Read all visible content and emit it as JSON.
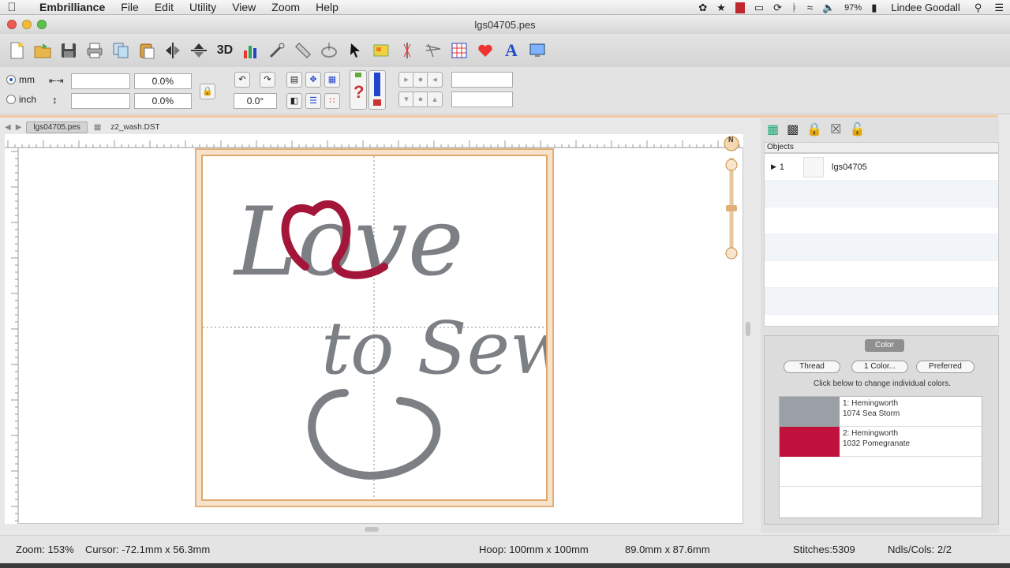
{
  "menubar": {
    "app_name": "Embrilliance",
    "menus": [
      "File",
      "Edit",
      "Utility",
      "View",
      "Zoom",
      "Help"
    ],
    "battery": "97%",
    "user": "Lindee Goodall"
  },
  "window": {
    "title": "lgs04705.pes"
  },
  "toolbar": {
    "icons": [
      "new-icon",
      "open-icon",
      "save-icon",
      "print-icon",
      "copy-icon",
      "paste-icon",
      "flip-horizontal-icon",
      "flip-vertical-icon",
      "3d-icon",
      "chart-icon",
      "wand-icon",
      "ruler-icon",
      "hoop-icon",
      "select-arrow-icon",
      "card-icon",
      "needle-icon",
      "stitch-icon",
      "grid-icon",
      "hearts-icon",
      "text-a-icon",
      "monitor-icon"
    ],
    "label_3d": "3D",
    "label_a": "A"
  },
  "props": {
    "mm_label": "mm",
    "inch_label": "inch",
    "width_pct": "0.0%",
    "height_pct": "0.0%",
    "rotation": "0.0°"
  },
  "doc_tabs": [
    "lgs04705.pes",
    "z2_wash.DST"
  ],
  "canvas": {
    "line1": "Love",
    "line2": "to Sew"
  },
  "objects": {
    "header": "Objects",
    "items": [
      {
        "index": "1",
        "name": "lgs04705"
      }
    ]
  },
  "color_panel": {
    "tab_label": "Color",
    "buttons": [
      "Thread",
      "1 Color...",
      "Preferred"
    ],
    "hint": "Click below to change individual colors.",
    "threads": [
      {
        "label1": "1: Hemingworth",
        "label2": "1074 Sea Storm",
        "color": "#9aa0a6"
      },
      {
        "label1": "2: Hemingworth",
        "label2": "1032 Pomegranate",
        "color": "#c0123c"
      }
    ]
  },
  "status": {
    "zoom": "Zoom: 153%",
    "cursor": "Cursor: -72.1mm x 56.3mm",
    "hoop": "Hoop: 100mm x 100mm",
    "size": "89.0mm x 87.6mm",
    "stitches": "Stitches:5309",
    "ndls": "Ndls/Cols: 2/2"
  },
  "colors": {
    "thread_gray": "#7c8084",
    "thread_red": "#a3163a",
    "hoop_orange": "#e0a86a"
  }
}
